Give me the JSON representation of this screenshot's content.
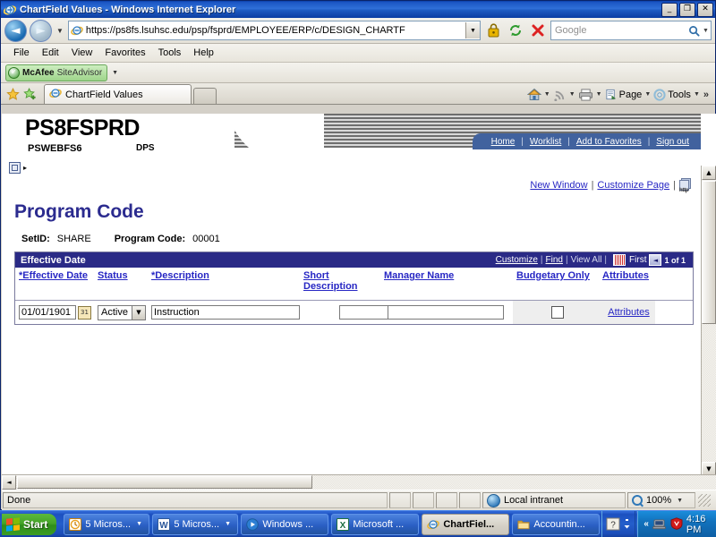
{
  "window": {
    "title": "ChartField Values - Windows Internet Explorer",
    "minimize": "_",
    "maximize": "❐",
    "close": "✕"
  },
  "browser": {
    "back_label": "◄",
    "forward_label": "►",
    "history_dropdown": "▼",
    "url": "https://ps8fs.lsuhsc.edu/psp/fsprd/EMPLOYEE/ERP/c/DESIGN_CHARTF",
    "url_dropdown": "▼",
    "lock_icon": "lock-icon",
    "refresh_icon": "refresh-icon",
    "stop_icon": "stop-icon",
    "search_placeholder": "Google",
    "search_value": "",
    "search_dropdown": "▼",
    "menu": [
      "File",
      "Edit",
      "View",
      "Favorites",
      "Tools",
      "Help"
    ],
    "mcafee": {
      "name": "McAfee",
      "sub": "SiteAdvisor",
      "check": "✓",
      "dropdown": "▼"
    },
    "tab_title": "ChartField Values",
    "command_bar": {
      "home_label": "",
      "feeds_label": "",
      "print_label": "",
      "page_label": "Page",
      "tools_label": "Tools",
      "overflow": "»",
      "caret": "▼"
    }
  },
  "peoplesoft": {
    "env_title": "PS8FSPRD",
    "server": "PSWEBFS6",
    "node": "DPS",
    "nav_links": [
      "Home",
      "Worklist",
      "Add to Favorites",
      "Sign out"
    ],
    "nav_sep": "|",
    "page_links": [
      "New Window",
      "Customize Page"
    ],
    "page_links_sep": "|",
    "help_icon_label": "http",
    "breadcrumb_arrow": "▸"
  },
  "page": {
    "title": "Program Code",
    "keys": [
      {
        "label": "SetID:",
        "value": "SHARE"
      },
      {
        "label": "Program Code:",
        "value": "00001"
      }
    ]
  },
  "grid": {
    "header_title": "Effective Date",
    "actions": [
      "Customize",
      "Find",
      "View All"
    ],
    "action_sep": "|",
    "grid_icon": "grid-icon",
    "nav_first_label": "First",
    "nav_prev_arrow": "◄",
    "nav_count": "1 of 1",
    "columns": [
      "*Effective Date",
      "Status",
      "*Description",
      "Short Description",
      "Manager Name",
      "Budgetary Only",
      "Attributes"
    ],
    "row": {
      "effective_date": "01/01/1901",
      "calendar_icon": "31",
      "status": "Active",
      "status_caret": "▼",
      "description": "Instruction",
      "short_description": "",
      "manager_name": "",
      "budgetary_only_checked": false,
      "attributes_link": "Attributes"
    }
  },
  "status_bar": {
    "message": "Done",
    "zone": "Local intranet",
    "zoom": "100%",
    "zoom_caret": "▼"
  },
  "scrollbars": {
    "up_arrow": "▲",
    "down_arrow": "▼",
    "left_arrow": "◄",
    "right_arrow": "►"
  },
  "taskbar": {
    "start_label": "Start",
    "buttons": [
      {
        "label": "5 Micros...",
        "icon": "outlook-icon",
        "active": false,
        "has_arrow": true
      },
      {
        "label": "5 Micros...",
        "icon": "word-icon",
        "active": false,
        "has_arrow": true
      },
      {
        "label": "Windows ...",
        "icon": "media-player-icon",
        "active": false,
        "has_arrow": false
      },
      {
        "label": "Microsoft ...",
        "icon": "excel-icon",
        "active": false,
        "has_arrow": false
      },
      {
        "label": "ChartFiel...",
        "icon": "ie-icon",
        "active": true,
        "has_arrow": false
      },
      {
        "label": "Accountin...",
        "icon": "folder-icon",
        "active": false,
        "has_arrow": false
      }
    ],
    "quick_help": "?",
    "tray_chevron": "«",
    "time": "4:16 PM"
  }
}
